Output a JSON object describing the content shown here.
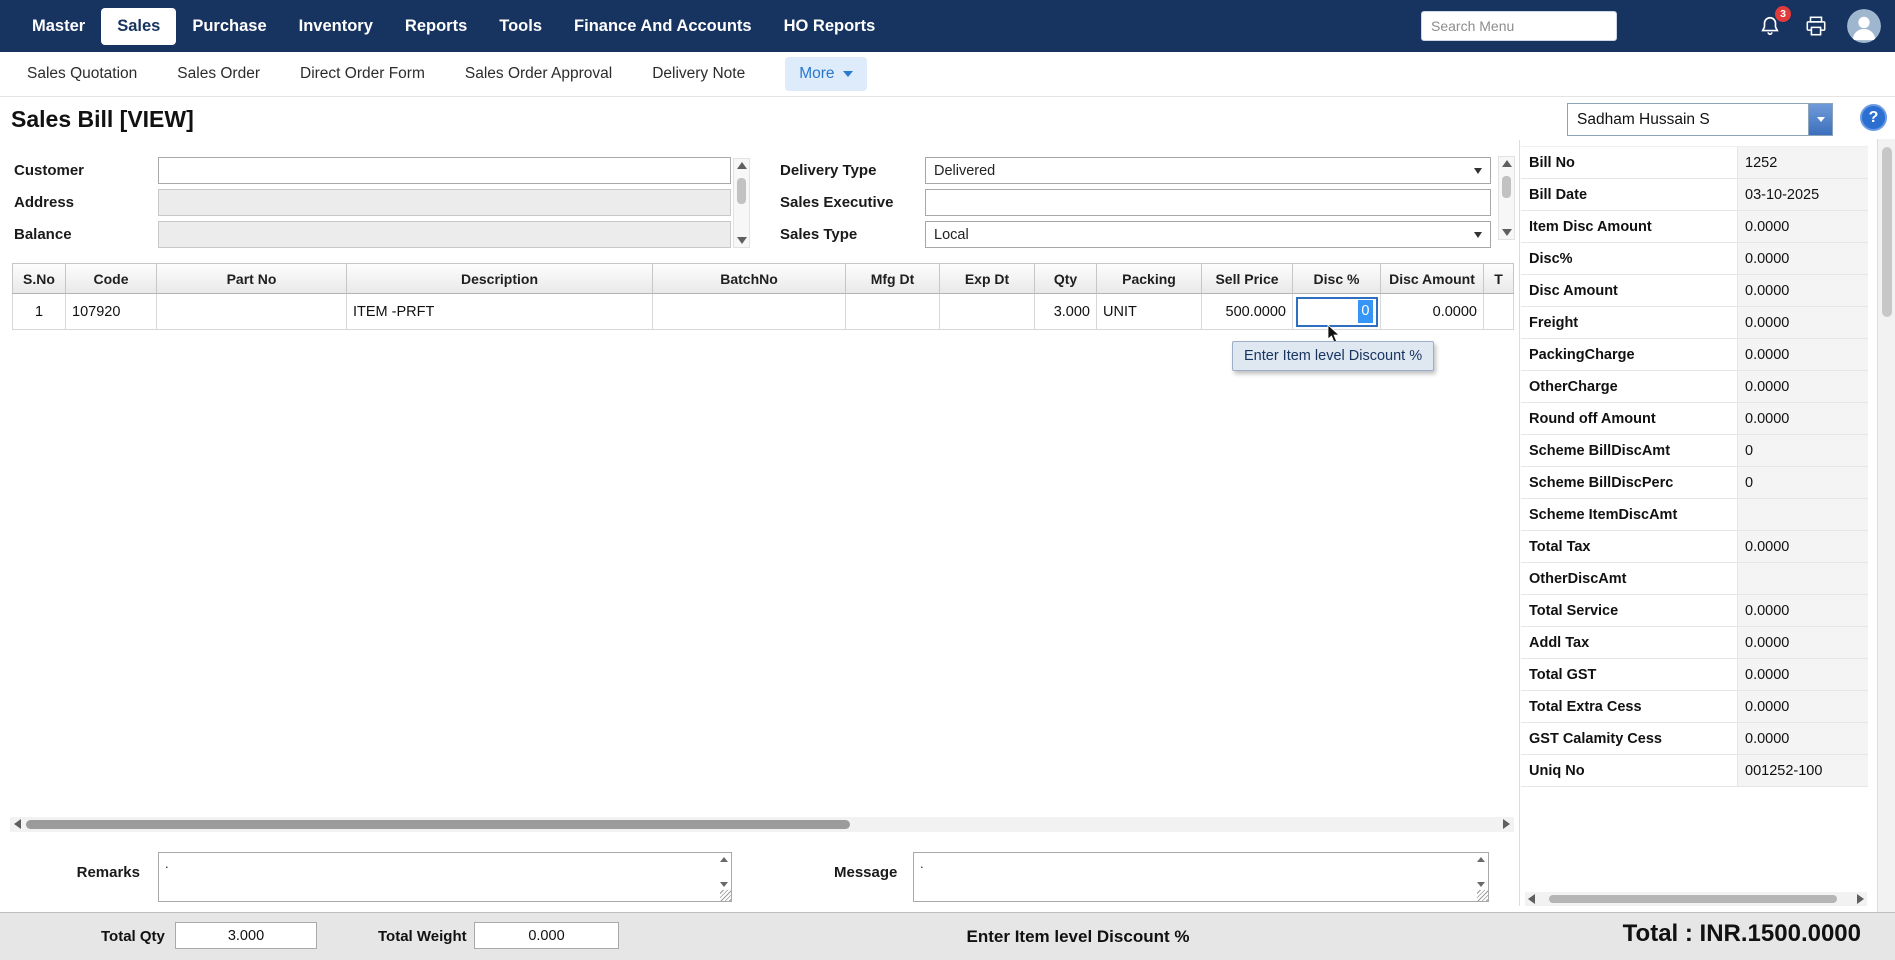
{
  "topnav": {
    "items": [
      "Master",
      "Sales",
      "Purchase",
      "Inventory",
      "Reports",
      "Tools",
      "Finance And Accounts",
      "HO Reports"
    ],
    "search_placeholder": "Search Menu",
    "notification_count": "3"
  },
  "subnav": {
    "items": [
      "Sales Quotation",
      "Sales Order",
      "Direct Order Form",
      "Sales Order Approval",
      "Delivery Note"
    ],
    "more": "More"
  },
  "page": {
    "title": "Sales Bill [VIEW]",
    "user": "Sadham Hussain S",
    "help_glyph": "?"
  },
  "form": {
    "customer": {
      "label": "Customer",
      "value": ""
    },
    "address": {
      "label": "Address",
      "value": ""
    },
    "balance": {
      "label": "Balance",
      "value": ""
    },
    "delivery_type": {
      "label": "Delivery Type",
      "value": "Delivered"
    },
    "sales_executive": {
      "label": "Sales Executive",
      "value": ""
    },
    "sales_type": {
      "label": "Sales Type",
      "value": "Local"
    }
  },
  "grid": {
    "headers": [
      "S.No",
      "Code",
      "Part No",
      "Description",
      "BatchNo",
      "Mfg Dt",
      "Exp Dt",
      "Qty",
      "Packing",
      "Sell Price",
      "Disc %",
      "Disc Amount",
      "T"
    ],
    "row": {
      "sno": "1",
      "code": "107920",
      "part_no": "",
      "description": "ITEM -PRFT",
      "batch_no": "",
      "mfg_dt": "",
      "exp_dt": "",
      "qty": "3.000",
      "packing": "UNIT",
      "sell_price": "500.0000",
      "disc_pct": "0",
      "disc_amount": "0.0000"
    },
    "tooltip": "Enter Item level Discount %"
  },
  "remarks": {
    "label": "Remarks",
    "value": "."
  },
  "message": {
    "label": "Message",
    "value": "."
  },
  "statusbar": {
    "total_qty_label": "Total Qty",
    "total_qty_value": "3.000",
    "total_weight_label": "Total Weight",
    "total_weight_value": "0.000",
    "hint": "Enter Item level Discount %",
    "grand_total": "Total : INR.1500.0000"
  },
  "summary": {
    "rows": [
      {
        "label": "Bill No",
        "value": "1252"
      },
      {
        "label": "Bill Date",
        "value": "03-10-2025"
      },
      {
        "label": "Item Disc Amount",
        "value": "0.0000"
      },
      {
        "label": "Disc%",
        "value": "0.0000"
      },
      {
        "label": "Disc Amount",
        "value": "0.0000"
      },
      {
        "label": "Freight",
        "value": "0.0000"
      },
      {
        "label": "PackingCharge",
        "value": "0.0000"
      },
      {
        "label": "OtherCharge",
        "value": "0.0000"
      },
      {
        "label": "Round off Amount",
        "value": "0.0000"
      },
      {
        "label": "Scheme BillDiscAmt",
        "value": "0"
      },
      {
        "label": "Scheme BillDiscPerc",
        "value": "0"
      },
      {
        "label": "Scheme ItemDiscAmt",
        "value": ""
      },
      {
        "label": "Total Tax",
        "value": "0.0000"
      },
      {
        "label": "OtherDiscAmt",
        "value": ""
      },
      {
        "label": "Total Service",
        "value": "0.0000"
      },
      {
        "label": "Addl Tax",
        "value": "0.0000"
      },
      {
        "label": "Total GST",
        "value": "0.0000"
      },
      {
        "label": "Total Extra Cess",
        "value": "0.0000"
      },
      {
        "label": "GST Calamity Cess",
        "value": "0.0000"
      },
      {
        "label": "Uniq No",
        "value": "001252-100"
      }
    ]
  },
  "colors": {
    "topnav_bg": "#17335f",
    "accent_blue": "#2878cc",
    "selection_blue": "#3596f7",
    "badge_red": "#e23b3b"
  }
}
